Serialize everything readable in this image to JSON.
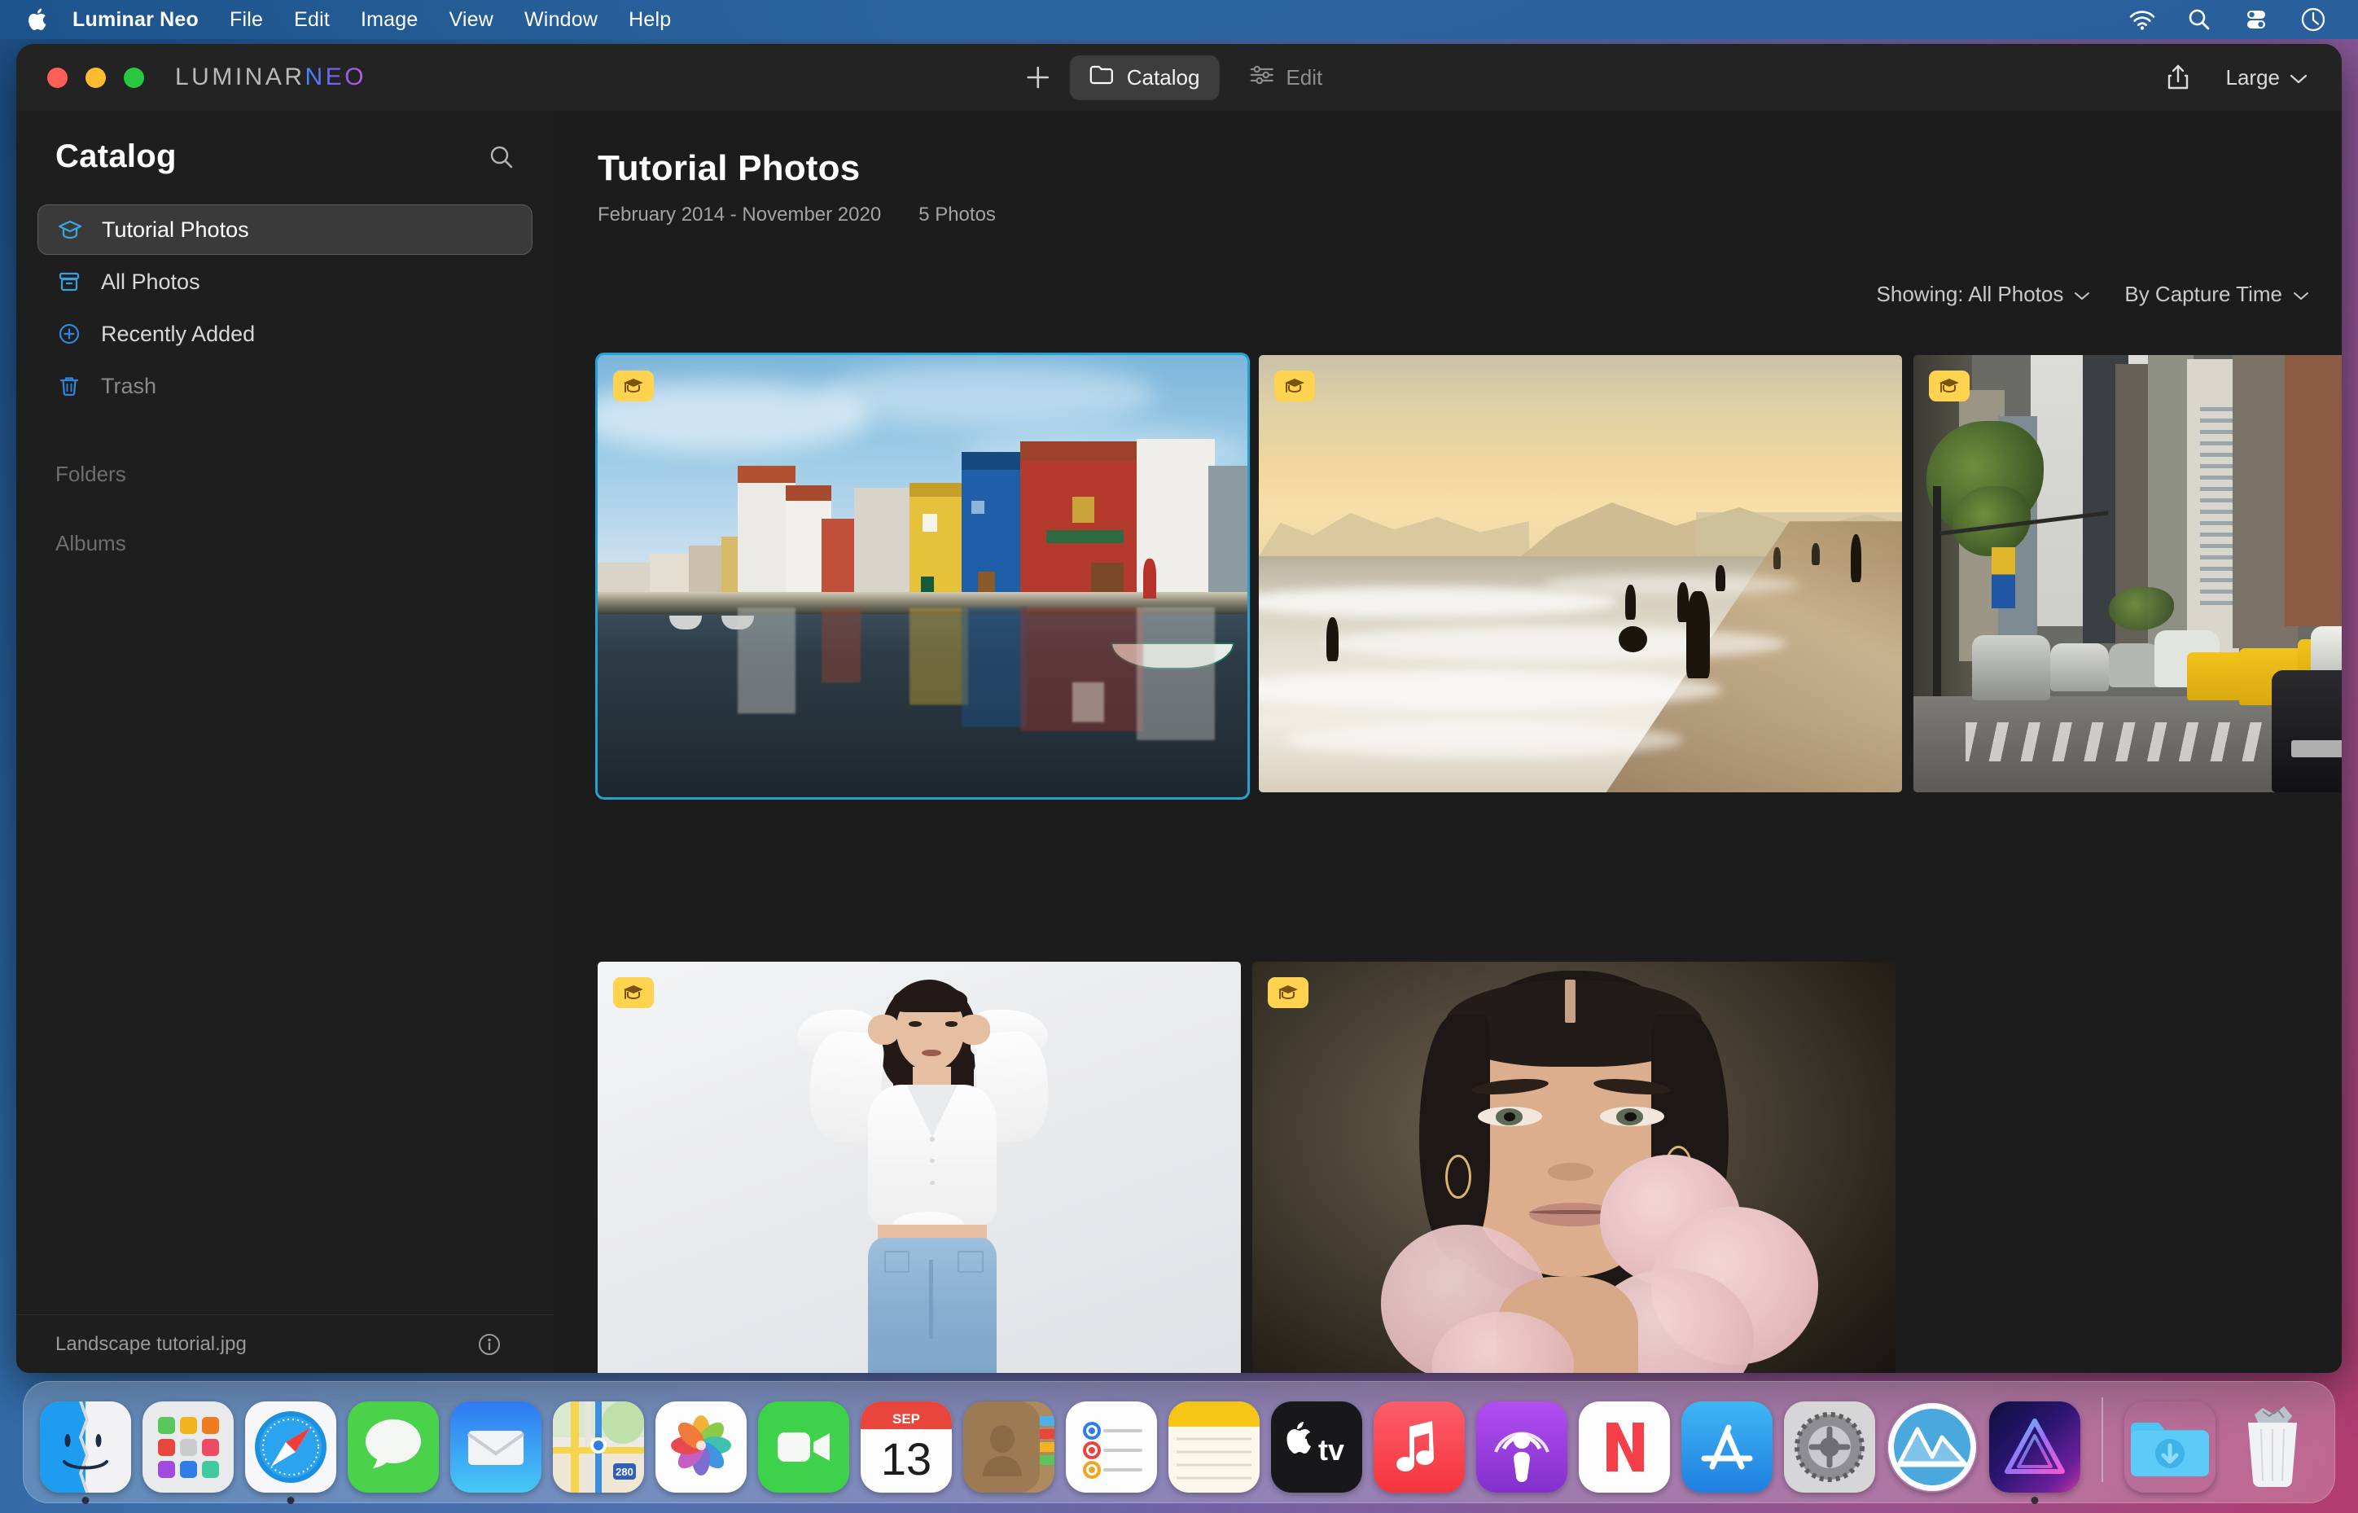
{
  "menubar": {
    "apple_icon": "apple-logo",
    "items": [
      {
        "label": "Luminar Neo",
        "bold": true
      },
      {
        "label": "File"
      },
      {
        "label": "Edit"
      },
      {
        "label": "Image"
      },
      {
        "label": "View"
      },
      {
        "label": "Window"
      },
      {
        "label": "Help"
      }
    ],
    "status_icons": [
      "wifi-icon",
      "spotlight-search-icon",
      "control-center-icon",
      "siri-clock-icon"
    ]
  },
  "window": {
    "brand_primary": "LUMINAR",
    "brand_accent": "NEO",
    "traffic_lights": [
      "close",
      "minimize",
      "zoom"
    ],
    "toolbar": {
      "add_label": "+",
      "catalog_tab": "Catalog",
      "edit_tab": "Edit",
      "share_icon": "share-icon",
      "size_label": "Large"
    }
  },
  "sidebar": {
    "title": "Catalog",
    "search_icon": "search-icon",
    "items": [
      {
        "label": "Tutorial Photos",
        "icon": "graduation-cap-icon",
        "selected": true
      },
      {
        "label": "All Photos",
        "icon": "archive-box-icon",
        "selected": false
      },
      {
        "label": "Recently Added",
        "icon": "plus-circle-icon",
        "selected": false
      },
      {
        "label": "Trash",
        "icon": "trash-icon",
        "selected": false,
        "dim": true
      }
    ],
    "sections": [
      {
        "label": "Folders"
      },
      {
        "label": "Albums"
      }
    ]
  },
  "statusbar": {
    "filename": "Landscape tutorial.jpg",
    "info_icon": "info-circle-icon"
  },
  "main": {
    "title": "Tutorial Photos",
    "date_range": "February 2014 - November 2020",
    "photo_count": "5 Photos",
    "filters": [
      {
        "label": "Showing: All Photos",
        "icon": "chevron-down-icon"
      },
      {
        "label": "By Capture Time",
        "icon": "chevron-down-icon"
      }
    ],
    "selection_color": "#22a3d8",
    "badge_color": "#ffd34f",
    "photos": [
      {
        "name": "Landscape tutorial.jpg",
        "scene": "colorful-canal-houses-reflection",
        "badge": "tutorial-badge",
        "selected": true
      },
      {
        "name": "Beach sunset",
        "scene": "beach-sunset-silhouettes",
        "badge": "tutorial-badge",
        "selected": false
      },
      {
        "name": "City street",
        "scene": "city-street-taxis",
        "badge": "tutorial-badge",
        "selected": false
      },
      {
        "name": "Studio portrait",
        "scene": "woman-white-shirt-jeans",
        "badge": "tutorial-badge",
        "selected": false
      },
      {
        "name": "Beauty portrait",
        "scene": "woman-pink-tulle-portrait",
        "badge": "tutorial-badge",
        "selected": false
      }
    ]
  },
  "dock": {
    "items": [
      {
        "name": "Finder",
        "icon": "finder-icon",
        "running": true
      },
      {
        "name": "Launchpad",
        "icon": "launchpad-icon",
        "running": false
      },
      {
        "name": "Safari",
        "icon": "safari-icon",
        "running": true
      },
      {
        "name": "Messages",
        "icon": "messages-icon",
        "running": false
      },
      {
        "name": "Mail",
        "icon": "mail-icon",
        "running": false
      },
      {
        "name": "Maps",
        "icon": "maps-icon",
        "running": false
      },
      {
        "name": "Photos",
        "icon": "photos-icon",
        "running": false
      },
      {
        "name": "FaceTime",
        "icon": "facetime-icon",
        "running": false
      },
      {
        "name": "Calendar",
        "icon": "calendar-icon",
        "running": false,
        "month": "SEP",
        "day": "13"
      },
      {
        "name": "Contacts",
        "icon": "contacts-icon",
        "running": false
      },
      {
        "name": "Reminders",
        "icon": "reminders-icon",
        "running": false
      },
      {
        "name": "Notes",
        "icon": "notes-icon",
        "running": false
      },
      {
        "name": "TV",
        "icon": "appletv-icon",
        "running": false
      },
      {
        "name": "Music",
        "icon": "music-icon",
        "running": false
      },
      {
        "name": "Podcasts",
        "icon": "podcasts-icon",
        "running": false
      },
      {
        "name": "News",
        "icon": "news-icon",
        "running": false
      },
      {
        "name": "App Store",
        "icon": "appstore-icon",
        "running": false
      },
      {
        "name": "System Preferences",
        "icon": "system-preferences-icon",
        "running": false
      },
      {
        "name": "Luminar AI",
        "icon": "luminar-ai-icon",
        "running": false
      },
      {
        "name": "Luminar Neo",
        "icon": "luminar-neo-icon",
        "running": true
      }
    ],
    "trailing": [
      {
        "name": "Downloads",
        "icon": "downloads-folder-icon"
      },
      {
        "name": "Trash",
        "icon": "trash-full-icon"
      }
    ]
  }
}
